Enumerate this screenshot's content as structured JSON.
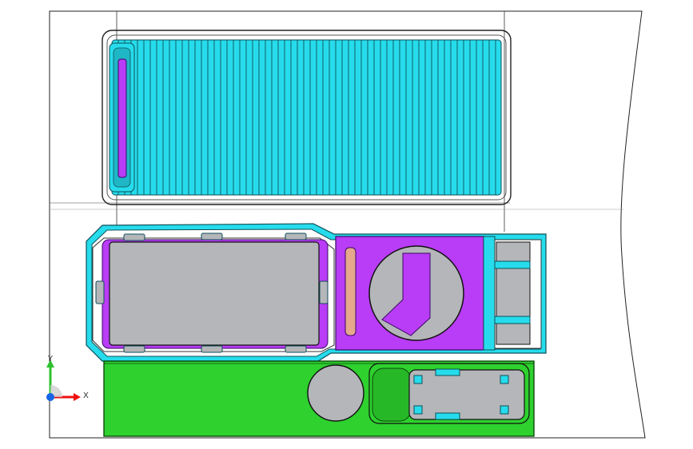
{
  "app": {
    "view": "top-view",
    "background": "#ffffff"
  },
  "colors": {
    "tray": "#26dcec",
    "purple": "#b93cf6",
    "green": "#2ed12e",
    "gray": "#b4b6ba",
    "edge": "#111111",
    "panel": "#ffffff",
    "salmon": "#e6a88d"
  },
  "triad": {
    "y_label": "Y",
    "x_label": "X",
    "icons": [
      "y-axis-arrow-icon",
      "x-axis-arrow-icon",
      "z-axis-dot-icon"
    ]
  }
}
